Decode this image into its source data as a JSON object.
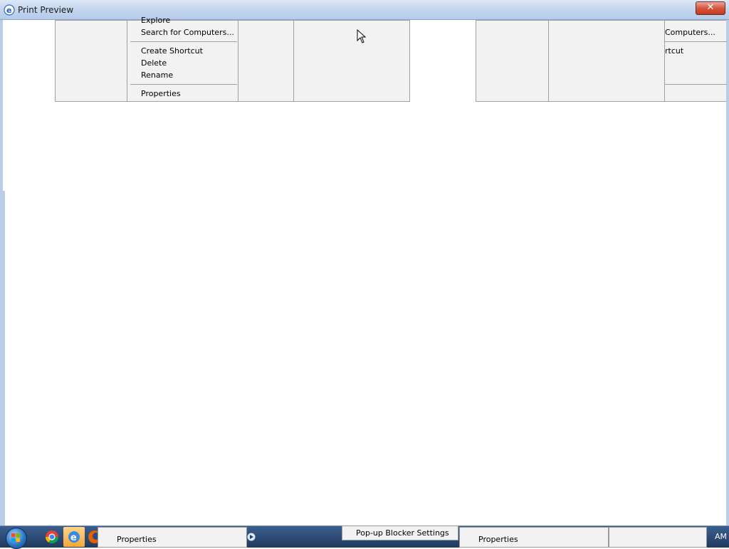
{
  "window": {
    "title": "Print Preview",
    "close_label": "✕"
  },
  "left_menu": {
    "items": [
      {
        "label": "Explore"
      },
      {
        "label": "Search for Computers..."
      },
      {
        "label": "Create Shortcut"
      },
      {
        "label": "Delete"
      },
      {
        "label": "Rename"
      },
      {
        "label": "Properties"
      }
    ]
  },
  "right_menu": {
    "items": [
      {
        "label": "Computers..."
      },
      {
        "label": "rtcut"
      }
    ]
  },
  "taskbar": {
    "properties_left": "Properties",
    "popup_blocker": "Pop-up Blocker Settings",
    "properties_right": "Properties",
    "clock": "AM"
  },
  "colors": {
    "titlebar": "#c3d5ee",
    "panel": "#f2f2f2",
    "taskbar": "#2a4a74",
    "close_button": "#d6553d"
  }
}
